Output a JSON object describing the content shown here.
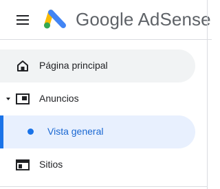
{
  "header": {
    "brand_google": "Google",
    "brand_product": "AdSense",
    "menu_icon": "hamburger-menu-icon",
    "logo_icon": "adsense-logo-icon",
    "colors": {
      "logo_yellow": "#fbbc04",
      "logo_blue": "#4285f4",
      "logo_green": "#34a853"
    }
  },
  "nav": {
    "home": {
      "label": "Página principal",
      "icon": "home-icon"
    },
    "ads": {
      "label": "Anuncios",
      "icon": "ad-frame-icon",
      "expanded": true
    },
    "overview": {
      "label": "Vista general",
      "selected": true
    },
    "sites": {
      "label": "Sitios",
      "icon": "sites-icon"
    }
  },
  "colors": {
    "accent": "#1a73e8",
    "selected_bg": "#e8f0fe",
    "hover_bg": "#f1f3f4"
  }
}
